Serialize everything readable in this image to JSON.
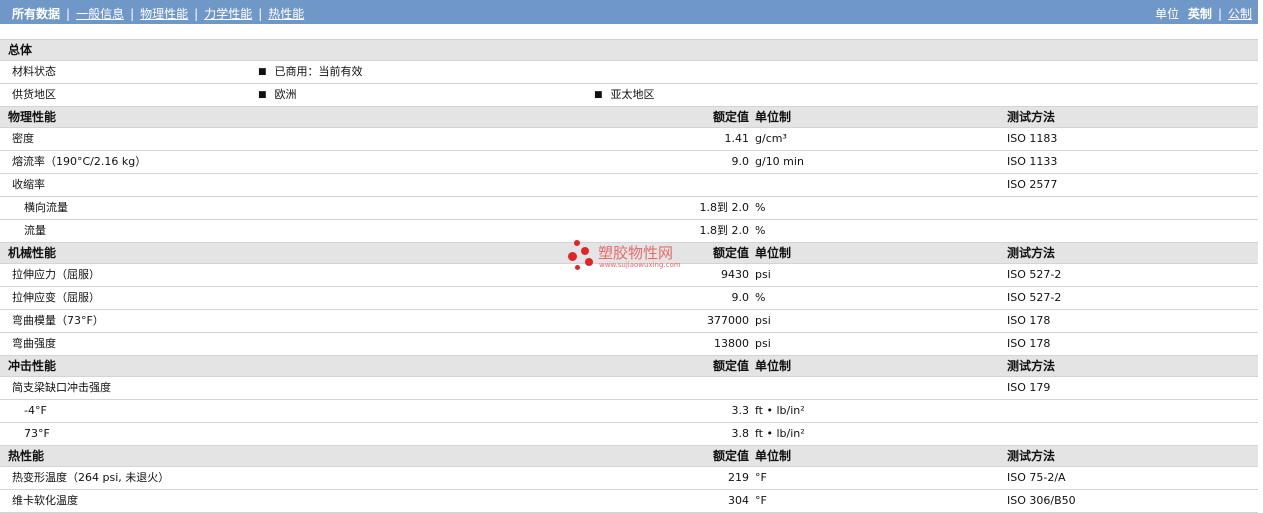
{
  "nav": {
    "items": [
      "所有数据",
      "一般信息",
      "物理性能",
      "力学性能",
      "热性能"
    ],
    "units_label": "单位",
    "unit_imperial": "英制",
    "unit_metric": "公制"
  },
  "watermark": {
    "title": "塑胶物性网",
    "url": "www.sujiaowuxing.com"
  },
  "general": {
    "title": "总体",
    "status_label": "材料状态",
    "status_value": "已商用：当前有效",
    "region_label": "供货地区",
    "region_1": "欧洲",
    "region_2": "亚太地区"
  },
  "sections": [
    {
      "title": "物理性能",
      "h_value": "额定值",
      "h_unit": "单位制",
      "h_method": "测试方法",
      "rows": [
        {
          "label": "密度",
          "value": "1.41",
          "unit": "g/cm³",
          "method": "ISO 1183"
        },
        {
          "label": "熔流率（190°C/2.16 kg）",
          "value": "9.0",
          "unit": "g/10 min",
          "method": "ISO 1133"
        },
        {
          "label": "收缩率",
          "value": "",
          "unit": "",
          "method": "ISO 2577"
        },
        {
          "label": "横向流量",
          "value": "1.8到 2.0",
          "unit": "%",
          "method": ""
        },
        {
          "label": "流量",
          "value": "1.8到 2.0",
          "unit": "%",
          "method": ""
        }
      ]
    },
    {
      "title": "机械性能",
      "h_value": "额定值",
      "h_unit": "单位制",
      "h_method": "测试方法",
      "rows": [
        {
          "label": "拉伸应力（屈服）",
          "value": "9430",
          "unit": "psi",
          "method": "ISO 527-2"
        },
        {
          "label": "拉伸应变（屈服）",
          "value": "9.0",
          "unit": "%",
          "method": "ISO 527-2"
        },
        {
          "label": "弯曲模量（73°F）",
          "value": "377000",
          "unit": "psi",
          "method": "ISO 178"
        },
        {
          "label": "弯曲强度",
          "value": "13800",
          "unit": "psi",
          "method": "ISO 178"
        }
      ]
    },
    {
      "title": "冲击性能",
      "h_value": "额定值",
      "h_unit": "单位制",
      "h_method": "测试方法",
      "rows": [
        {
          "label": "简支梁缺口冲击强度",
          "value": "",
          "unit": "",
          "method": "ISO 179"
        },
        {
          "label": "-4°F",
          "value": "3.3",
          "unit": "ft • lb/in²",
          "method": ""
        },
        {
          "label": "73°F",
          "value": "3.8",
          "unit": "ft • lb/in²",
          "method": ""
        }
      ]
    },
    {
      "title": "热性能",
      "h_value": "额定值",
      "h_unit": "单位制",
      "h_method": "测试方法",
      "rows": [
        {
          "label": "热变形温度（264 psi, 未退火）",
          "value": "219",
          "unit": "°F",
          "method": "ISO 75-2/A"
        },
        {
          "label": "维卡软化温度",
          "value": "304",
          "unit": "°F",
          "method": "ISO 306/B50"
        }
      ]
    }
  ]
}
